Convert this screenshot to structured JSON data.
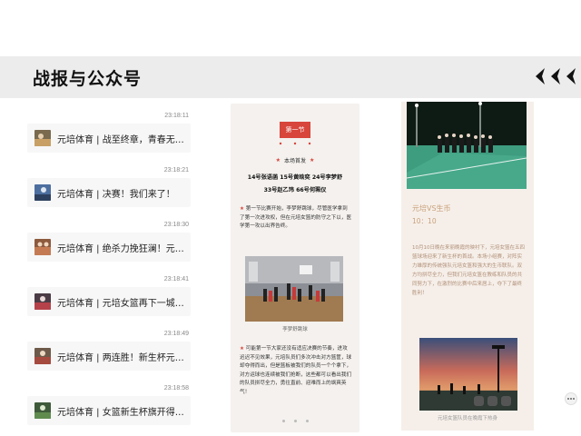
{
  "header": {
    "title": "战报与公众号",
    "nav_icon": "triple-chevron-left-icon"
  },
  "chats": [
    {
      "time": "23:18:11",
      "text": "元培体育 | 战至终章，青春无憾！"
    },
    {
      "time": "23:18:21",
      "text": "元培体育 | 决赛！我们来了！"
    },
    {
      "time": "23:18:30",
      "text": "元培体育 | 绝杀力挽狂澜！元培..."
    },
    {
      "time": "23:18:41",
      "text": "元培体育 | 元培女篮再下一城，..."
    },
    {
      "time": "23:18:49",
      "text": "元培体育 | 两连胜！新生杯元培..."
    },
    {
      "time": "23:18:58",
      "text": "元培体育 | 女篮新生杯旗开得胜..."
    }
  ],
  "article1": {
    "section_tag": "第一节",
    "sub_heading": "本场首发",
    "roster": [
      "14号张语菡 15号黄晗奕 24号李梦舒",
      "33号赵乙玮 66号何珮仪"
    ],
    "para1": "第一节比赛开始，李梦舒跳球，尽管医学拿到了第一次进攻权，但在元培女篮的防守之下以，医学第一攻以出界告终。",
    "photo_caption": "李梦舒跳球",
    "para2": "可能第一节大家还没有适应决赛的节奏，进攻迟迟不见效果，元培队员们多次冲击对方篮筐，球却夺得而出，但是篮板被我们的队员一个个拿下，对方运球也连续被我们抢断，这些都可以看出我们的队员拼尽全力，勇往直前、迎难而上的飒爽英气！"
  },
  "article2": {
    "title": "元培VS生币",
    "date": "10：10",
    "paragraph": "10月10日晚在来丽晚霞的映衬下，元培女篮在五四篮球场迎来了新生杯的首战。本场小组赛，对阵实力雄厚的传统强队元培女篮和强大的生币联队。双方均拼尽全力，但我们元培女篮在教练和队员的共同努力下，在激烈的比赛中后来居上，夺下了最终胜利！",
    "caption": "元培女篮队员在晚霞下热身"
  }
}
